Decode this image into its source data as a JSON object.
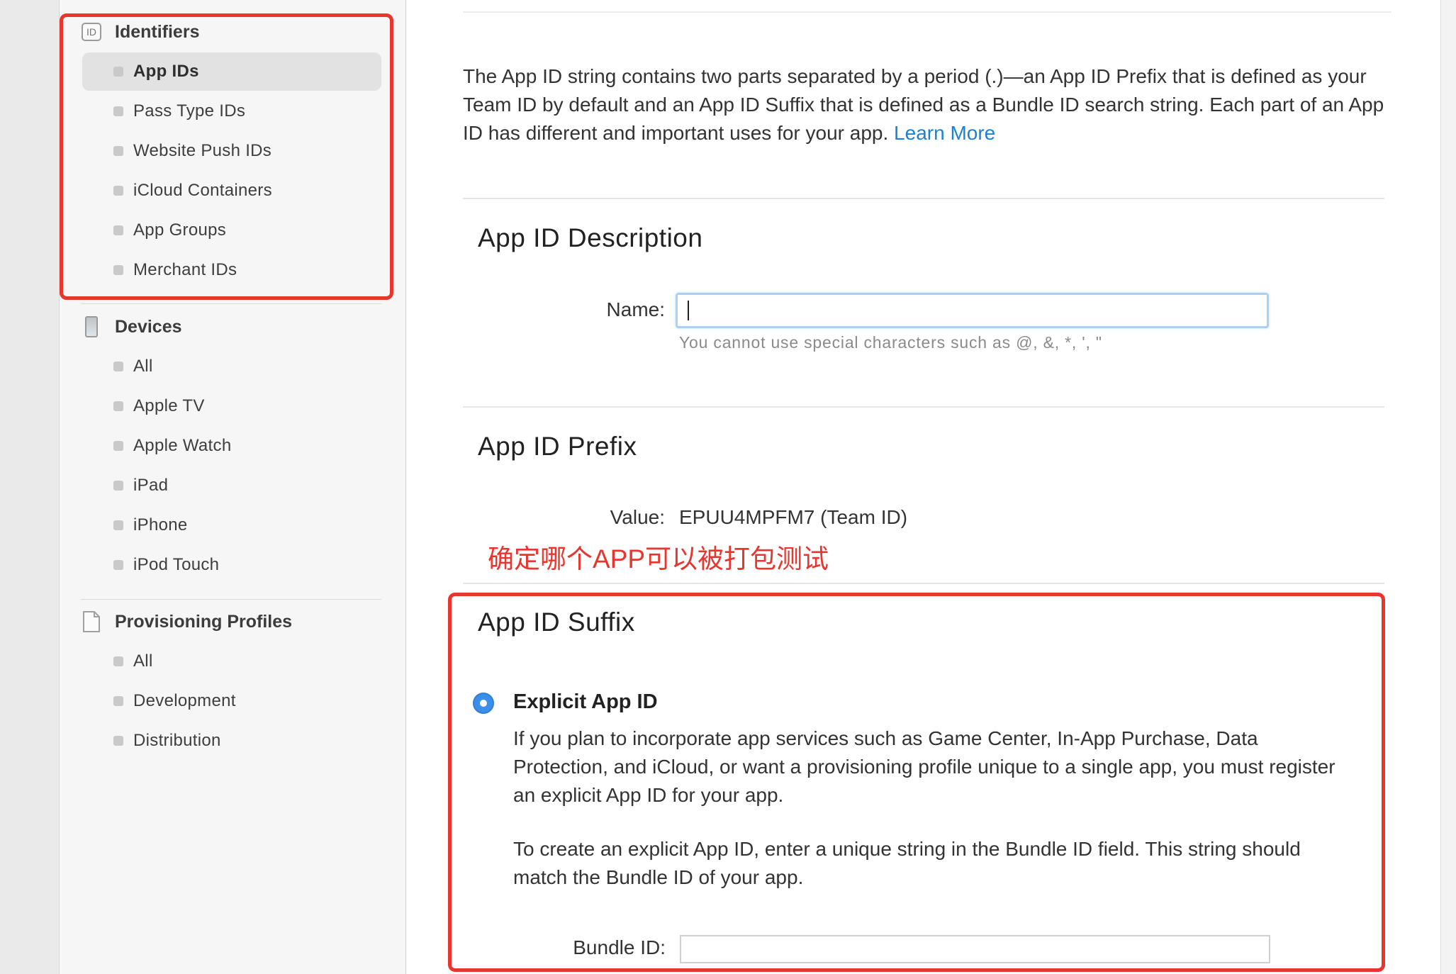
{
  "sidebar": {
    "identifiers": {
      "heading": "Identifiers",
      "icon": "id-icon",
      "icon_text": "ID",
      "items": [
        {
          "label": "App IDs",
          "active": true
        },
        {
          "label": "Pass Type IDs"
        },
        {
          "label": "Website Push IDs"
        },
        {
          "label": "iCloud Containers"
        },
        {
          "label": "App Groups"
        },
        {
          "label": "Merchant IDs"
        }
      ]
    },
    "devices": {
      "heading": "Devices",
      "icon": "device-icon",
      "items": [
        {
          "label": "All"
        },
        {
          "label": "Apple TV"
        },
        {
          "label": "Apple Watch"
        },
        {
          "label": "iPad"
        },
        {
          "label": "iPhone"
        },
        {
          "label": "iPod Touch"
        }
      ]
    },
    "profiles": {
      "heading": "Provisioning Profiles",
      "icon": "document-icon",
      "items": [
        {
          "label": "All"
        },
        {
          "label": "Development"
        },
        {
          "label": "Distribution"
        }
      ]
    }
  },
  "main": {
    "intro": {
      "text": "The App ID string contains two parts separated by a period (.)—an App ID Prefix that is defined as your Team ID by default and an App ID Suffix that is defined as a Bundle ID search string. Each part of an App ID has different and important uses for your app.",
      "link": "Learn More"
    },
    "description": {
      "title": "App ID Description",
      "name_label": "Name:",
      "name_value": "",
      "hint": "You cannot use special characters such as @, &, *, ', \""
    },
    "prefix": {
      "title": "App ID Prefix",
      "value_label": "Value:",
      "value": "EPUU4MPFM7 (Team ID)"
    },
    "annotation": "确定哪个APP可以被打包测试",
    "suffix": {
      "title": "App ID Suffix",
      "option_title": "Explicit App ID",
      "option_selected": true,
      "desc1": "If you plan to incorporate app services such as Game Center, In-App Purchase, Data Protection, and iCloud, or want a provisioning profile unique to a single app, you must register an explicit App ID for your app.",
      "desc2": "To create an explicit App ID, enter a unique string in the Bundle ID field. This string should match the Bundle ID of your app.",
      "bundle_label": "Bundle ID:",
      "bundle_value": ""
    }
  },
  "colors": {
    "annotation_red": "#e8352e",
    "link_blue": "#1a82d6",
    "radio_blue": "#3b8eea",
    "input_focus": "#a9d0f5"
  }
}
